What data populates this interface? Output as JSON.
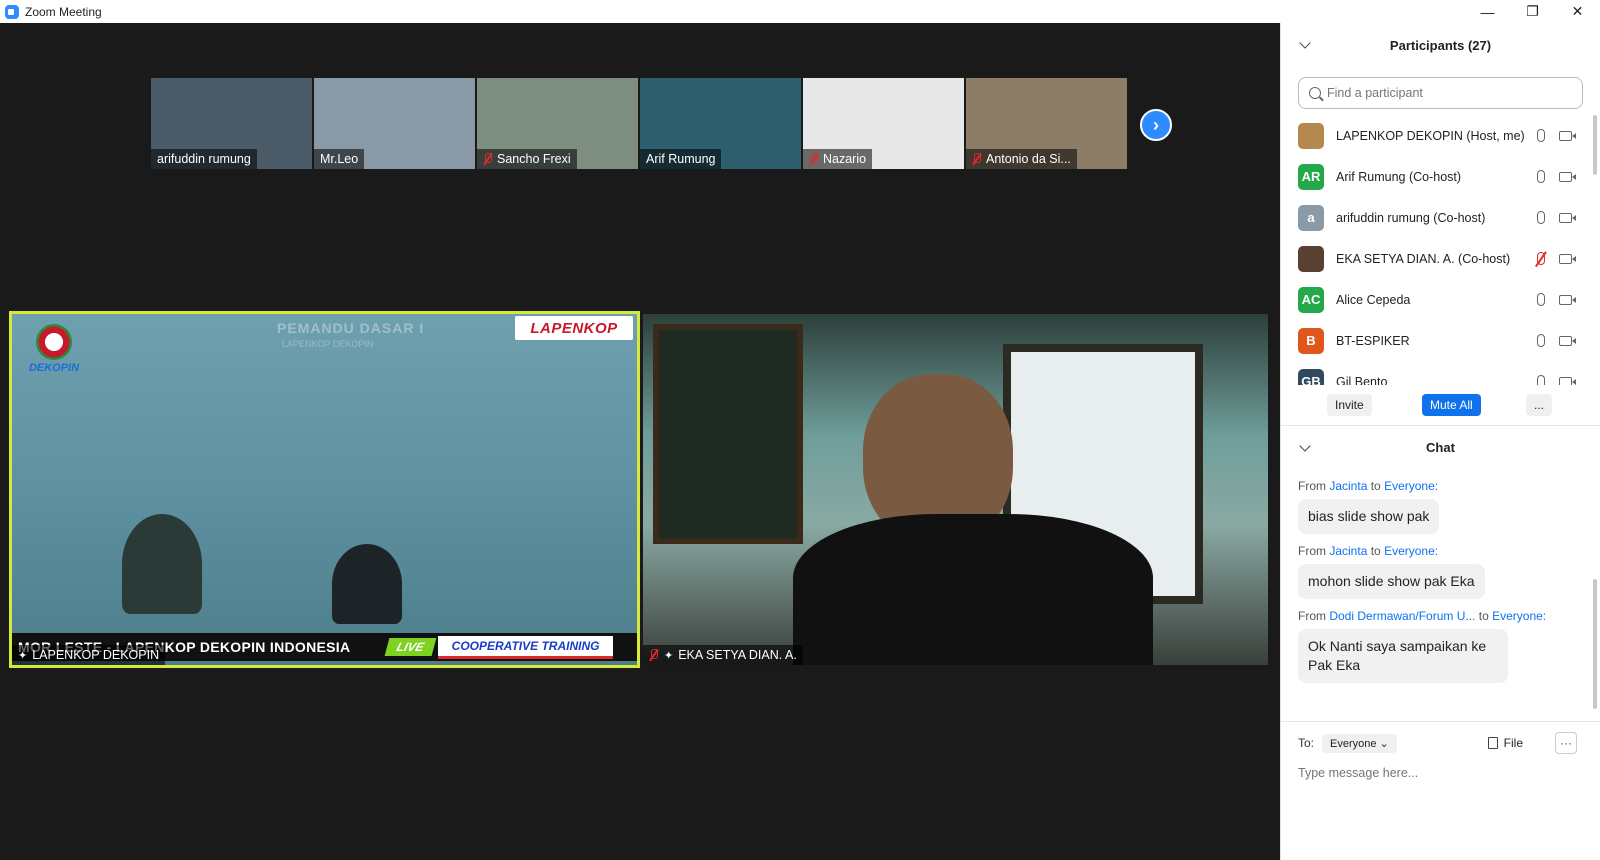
{
  "window": {
    "title": "Zoom Meeting",
    "minimize": "—",
    "restore": "❐",
    "close": "✕"
  },
  "thumbnails": [
    {
      "name": "arifuddin rumung",
      "muted": false,
      "bg": "#4a5a66"
    },
    {
      "name": "Mr.Leo",
      "muted": false,
      "bg": "#8a99a6"
    },
    {
      "name": "Sancho Frexi",
      "muted": true,
      "bg": "#7d8d80"
    },
    {
      "name": "Arif Rumung",
      "muted": false,
      "bg": "#2e5f6e"
    },
    {
      "name": "Nazario",
      "muted": true,
      "bg": "#e8e8e8"
    },
    {
      "name": "Antonio da Si...",
      "muted": true,
      "bg": "#8c7d66"
    }
  ],
  "main_tiles": {
    "left": {
      "name": "LAPENKOP DEKOPIN",
      "banner": "MOR LESTE - LAPENKOP DEKOPIN INDONESIA",
      "live": "LIVE",
      "training": "COOPERATIVE TRAINING",
      "logo": "LAPENKOP",
      "org": "DEKOPIN",
      "bg_title": "PEMANDU DASAR I",
      "bg_sub": "LAPENKOP DEKOPIN"
    },
    "right": {
      "name": "EKA SETYA DIAN. A."
    }
  },
  "participants": {
    "title": "Participants (27)",
    "search_placeholder": "Find a participant",
    "list": [
      {
        "initials": "",
        "name": "LAPENKOP DEKOPIN (Host, me)",
        "color": "#b5884f",
        "mic_off": false
      },
      {
        "initials": "AR",
        "name": "Arif Rumung (Co-host)",
        "color": "#23a84a",
        "mic_off": false
      },
      {
        "initials": "a",
        "name": "arifuddin rumung (Co-host)",
        "color": "#8a9aa6",
        "mic_off": false
      },
      {
        "initials": "",
        "name": "EKA SETYA DIAN. A. (Co-host)",
        "color": "#5a4030",
        "mic_off": true
      },
      {
        "initials": "AC",
        "name": "Alice Cepeda",
        "color": "#23a84a",
        "mic_off": false
      },
      {
        "initials": "B",
        "name": "BT-ESPIKER",
        "color": "#e0571e",
        "mic_off": false
      },
      {
        "initials": "GB",
        "name": "Gil Bento",
        "color": "#2f4a60",
        "mic_off": false
      }
    ],
    "invite": "Invite",
    "mute_all": "Mute All",
    "more": "..."
  },
  "chat": {
    "title": "Chat",
    "messages": [
      {
        "from_prefix": "From",
        "sender": "Jacinta",
        "to_prefix": "to",
        "to": "Everyone:",
        "text": "bias slide show pak"
      },
      {
        "from_prefix": "From",
        "sender": "Jacinta",
        "to_prefix": "to",
        "to": "Everyone:",
        "text": "mohon slide show pak Eka"
      },
      {
        "from_prefix": "From",
        "sender": "Dodi Dermawan/Forum U...",
        "to_prefix": "to",
        "to": "Everyone:",
        "text": "Ok Nanti saya sampaikan ke Pak Eka"
      }
    ],
    "to_label": "To:",
    "to_value": "Everyone",
    "file_label": "File",
    "more": "···",
    "input_placeholder": "Type message here..."
  }
}
